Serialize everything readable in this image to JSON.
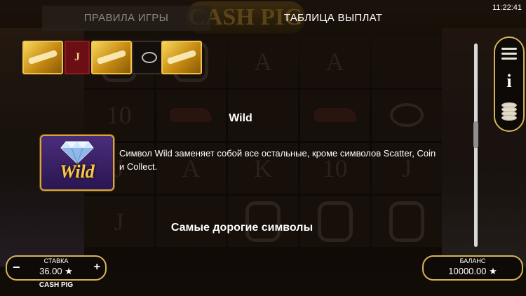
{
  "header": {
    "tab_rules": "ПРАВИЛА ИГРЫ",
    "tab_paytable": "ТАБЛИЦА ВЫПЛАТ",
    "clock": "11:22:41",
    "background_banner": "CASH PIG"
  },
  "mini_reels": {
    "letter": "J"
  },
  "content": {
    "wild_title": "Wild",
    "wild_icon_text": "Wild",
    "wild_description": "Символ Wild заменяет собой все остальные, кроме символов Scatter, Coin и Collect.",
    "top_symbols_title": "Самые дорогие символы"
  },
  "side_menu": {
    "info_glyph": "i",
    "icons": [
      "menu-icon",
      "info-icon",
      "coins-icon"
    ]
  },
  "bet": {
    "label": "СТАВКА",
    "value": "36.00 ★",
    "minus": "−",
    "plus": "+"
  },
  "game_name": "CASH PIG",
  "balance": {
    "label": "БАЛАНС",
    "value": "10000.00 ★"
  },
  "colors": {
    "accent_gold": "#d6b25a",
    "wild_text": "#f6c64a",
    "tab_inactive_text": "#8c8780"
  }
}
